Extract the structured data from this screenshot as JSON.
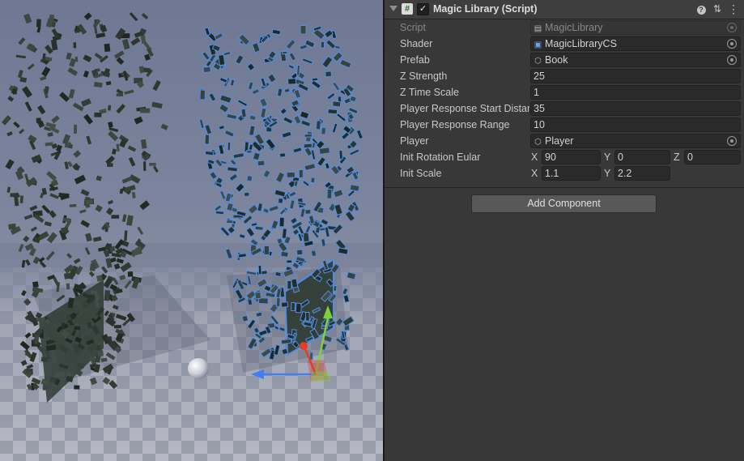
{
  "component": {
    "title": "Magic Library (Script)",
    "enabled": true,
    "icons": [
      "fold-arrow-icon",
      "script-hash-icon",
      "checkbox-icon",
      "help-icon",
      "preset-sliders-icon",
      "kebab-menu-icon"
    ],
    "badge_glyph": "#",
    "check_glyph": "✓",
    "help_glyph": "?",
    "preset_glyph": "⇅",
    "menu_glyph": "⋮"
  },
  "fields": {
    "script": {
      "label": "Script",
      "value": "MagicLibrary"
    },
    "shader": {
      "label": "Shader",
      "value": "MagicLibraryCS"
    },
    "prefab": {
      "label": "Prefab",
      "value": "Book"
    },
    "z_strength": {
      "label": "Z Strength",
      "value": "25"
    },
    "z_time_scale": {
      "label": "Z Time Scale",
      "value": "1"
    },
    "player_response_start_distance": {
      "label": "Player Response Start Distance",
      "value": "35"
    },
    "player_response_range": {
      "label": "Player Response Range",
      "value": "10"
    },
    "player": {
      "label": "Player",
      "value": "Player"
    },
    "init_rotation_eular": {
      "label": "Init Rotation Eular",
      "x_label": "X",
      "x": "90",
      "y_label": "Y",
      "y": "0",
      "z_label": "Z",
      "z": "0"
    },
    "init_scale": {
      "label": "Init Scale",
      "x_label": "X",
      "x": "1.1",
      "y_label": "Y",
      "y": "2.2"
    }
  },
  "add_component_label": "Add Component",
  "colors": {
    "inspector_bg": "#383838",
    "field_bg": "#2a2a2a",
    "button_bg": "#585858",
    "selection_outline": "#4f8fe6",
    "gizmo_y": "#7fd13b",
    "gizmo_x": "#e23c2c",
    "gizmo_z": "#3f7ff0"
  }
}
